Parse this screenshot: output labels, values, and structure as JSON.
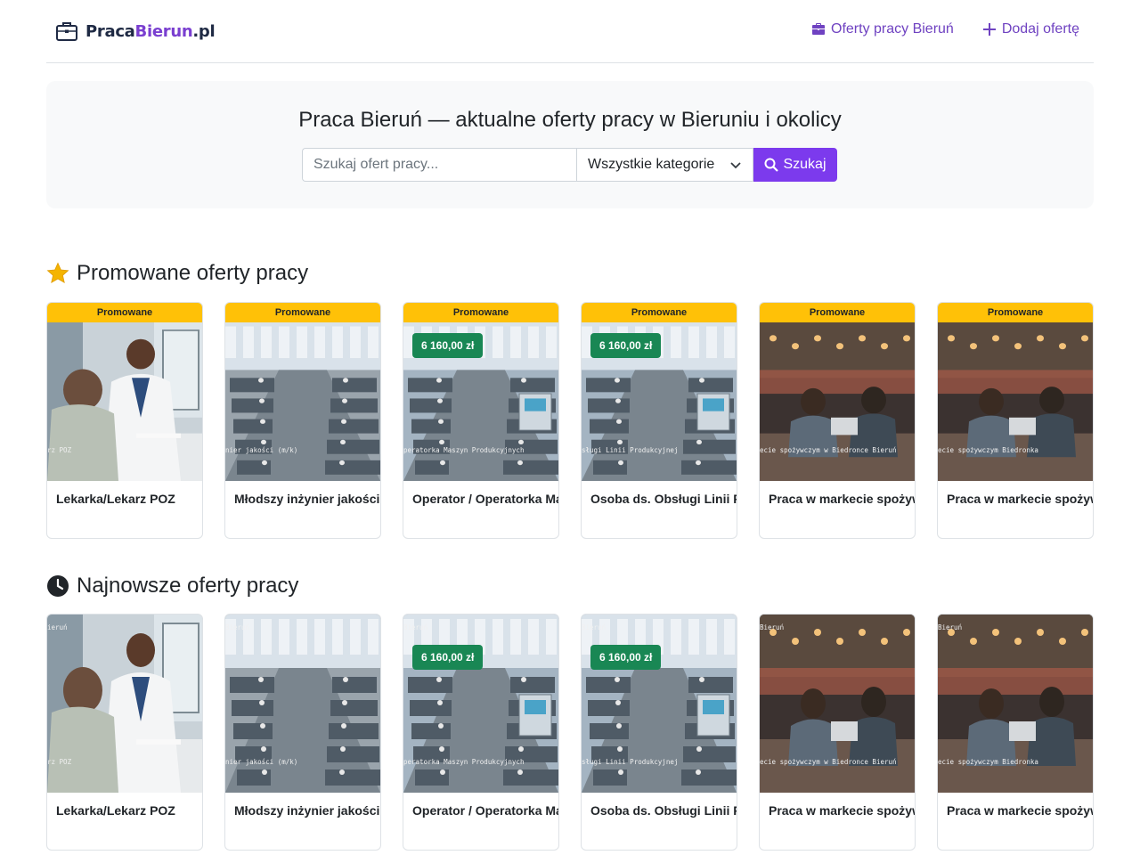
{
  "header": {
    "logo": {
      "part1": "Praca",
      "part2": "Bierun",
      "part3": ".pl",
      "icon": "briefcase-icon"
    },
    "nav": [
      {
        "label": "Oferty pracy Bieruń",
        "icon": "briefcase-icon"
      },
      {
        "label": "Dodaj ofertę",
        "icon": "plus-icon"
      }
    ]
  },
  "hero": {
    "title": "Praca Bieruń — aktualne oferty pracy w Bieruniu i okolicy",
    "search_placeholder": "Szukaj ofert pracy...",
    "category_selected": "Wszystkie kategorie",
    "search_button": "Szukaj"
  },
  "promoted": {
    "title": "Promowane oferty pracy",
    "badge": "Promowane",
    "cards": [
      {
        "title": "Lekarka/Lekarz POZ",
        "salary": "",
        "caption": "rz POZ",
        "scene": "doctor"
      },
      {
        "title": "Młodszy inżynier jakości",
        "salary": "",
        "caption": "nier jakości (m/k)",
        "scene": "factory"
      },
      {
        "title": "Operator / Operatorka Ma",
        "salary": "6 160,00 zł",
        "caption": "peratorka Maszyn Produkcyjnych",
        "scene": "factory2"
      },
      {
        "title": "Osoba ds. Obsługi Linii P",
        "salary": "6 160,00 zł",
        "caption": "sługi Linii Produkcyjnej",
        "scene": "factory3"
      },
      {
        "title": "Praca w markecie spożyw",
        "salary": "",
        "caption": "ecie spożywczym w Biedronce Bieruń",
        "scene": "office"
      },
      {
        "title": "Praca w markecie spożyw",
        "salary": "",
        "caption": "ecie spożywczym Biedronka",
        "scene": "office"
      }
    ]
  },
  "latest": {
    "title": "Najnowsze oferty pracy",
    "cards": [
      {
        "title": "Lekarka/Lekarz POZ",
        "salary": "",
        "tag": "ieruń",
        "caption": "rz POZ",
        "scene": "doctor"
      },
      {
        "title": "Młodszy inżynier jakości",
        "salary": "",
        "tag": "Bieruń",
        "caption": "nier jakości (m/k)",
        "scene": "factory"
      },
      {
        "title": "Operator / Operatorka Ma",
        "salary": "6 160,00 zł",
        "tag": "Bieruń",
        "caption": "peratorka Maszyn Produkcyjnych",
        "scene": "factory2"
      },
      {
        "title": "Osoba ds. Obsługi Linii P",
        "salary": "6 160,00 zł",
        "tag": "Bieruń",
        "caption": "sługi Linii Produkcyjnej",
        "scene": "factory3"
      },
      {
        "title": "Praca w markecie spożyw",
        "salary": "",
        "tag": "Bieruń",
        "caption": "ecie spożywczym w Biedronce Bieruń",
        "scene": "office"
      },
      {
        "title": "Praca w markecie spożyw",
        "salary": "",
        "tag": "Bieruń",
        "caption": "ecie spożywczym Biedronka",
        "scene": "office"
      }
    ]
  },
  "colors": {
    "accent": "#7c3aed",
    "nav_link": "#6f42c1",
    "promo_band": "#ffc107",
    "salary_badge": "#198754",
    "star": "#f4b400"
  }
}
